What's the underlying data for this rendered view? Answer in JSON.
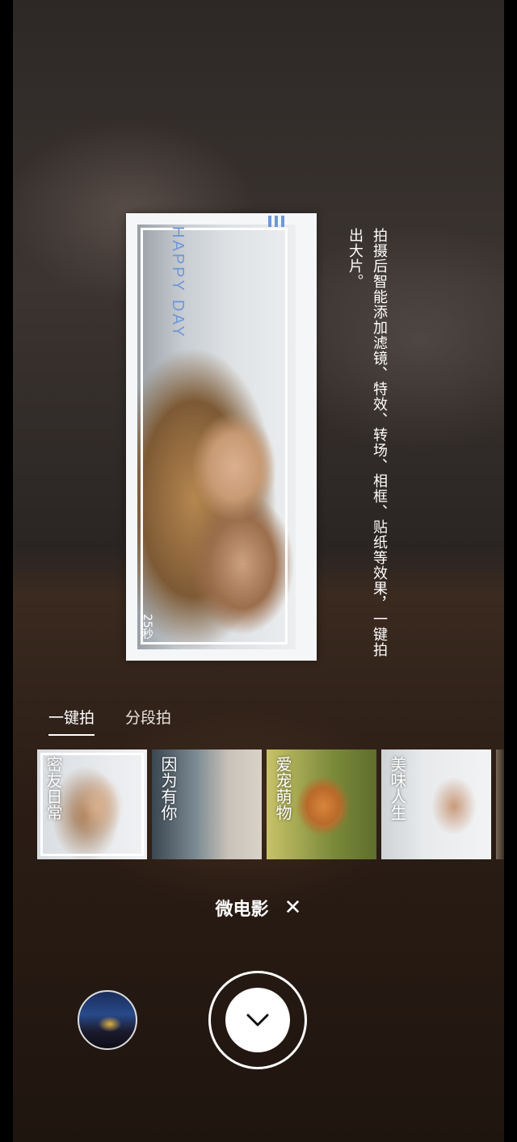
{
  "preview": {
    "frame_text": "HAPPY DAY",
    "duration": "25秒"
  },
  "hint": {
    "text": "拍摄后智能添加滤镜、特效、转场、相框、贴纸等效果，一键拍出大片。"
  },
  "mode_tabs": [
    {
      "label": "一键拍",
      "active": true
    },
    {
      "label": "分段拍",
      "active": false
    }
  ],
  "templates": [
    {
      "label": "密友日常",
      "selected": true
    },
    {
      "label": "因为有你",
      "selected": false
    },
    {
      "label": "爱宠萌物",
      "selected": false
    },
    {
      "label": "美味人生",
      "selected": false
    }
  ],
  "effect": {
    "name": "微电影",
    "close_symbol": "✕"
  },
  "icons": {
    "shutter": "chevron-down-icon",
    "close": "close-icon",
    "gallery": "gallery-thumbnail"
  },
  "colors": {
    "frame_accent": "#6f97d8",
    "text": "#ffffff"
  }
}
